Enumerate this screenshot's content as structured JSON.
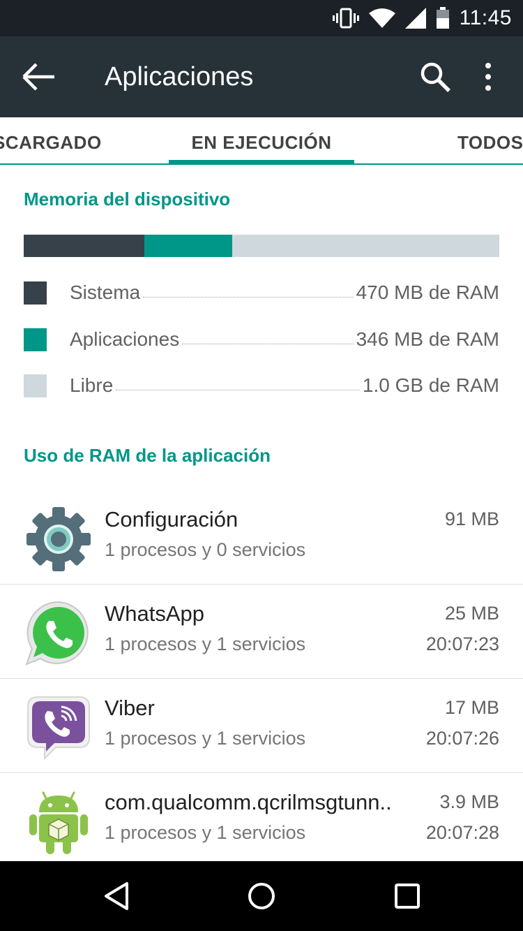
{
  "status": {
    "time": "11:45"
  },
  "appbar": {
    "title": "Aplicaciones"
  },
  "tabs": [
    {
      "label": "SCARGADO"
    },
    {
      "label": "EN EJECUCIÓN"
    },
    {
      "label": "TODOS"
    }
  ],
  "memory": {
    "header": "Memoria del dispositivo",
    "usage_fractions": {
      "sistema": 0.253,
      "aplicaciones": 0.186
    },
    "legend": [
      {
        "label": "Sistema",
        "value": "470 MB de RAM",
        "color": "#37414a"
      },
      {
        "label": "Aplicaciones",
        "value": "346 MB de RAM",
        "color": "#009688"
      },
      {
        "label": "Libre",
        "value": "1.0 GB de RAM",
        "color": "#cfd8dc"
      }
    ]
  },
  "apps": {
    "header": "Uso de RAM de la aplicación",
    "items": [
      {
        "name": "Configuración",
        "sub": "1 procesos y 0 servicios",
        "size": "91 MB",
        "time": ""
      },
      {
        "name": "WhatsApp",
        "sub": "1 procesos y 1 servicios",
        "size": "25 MB",
        "time": "20:07:23"
      },
      {
        "name": "Viber",
        "sub": "1 procesos y 1 servicios",
        "size": "17 MB",
        "time": "20:07:26"
      },
      {
        "name": "com.qualcomm.qcrilmsgtunn..",
        "sub": "1 procesos y 1 servicios",
        "size": "3.9 MB",
        "time": "20:07:28"
      }
    ]
  },
  "colors": {
    "accent": "#009688",
    "appbar": "#263238",
    "statusbar": "#1b2127"
  }
}
